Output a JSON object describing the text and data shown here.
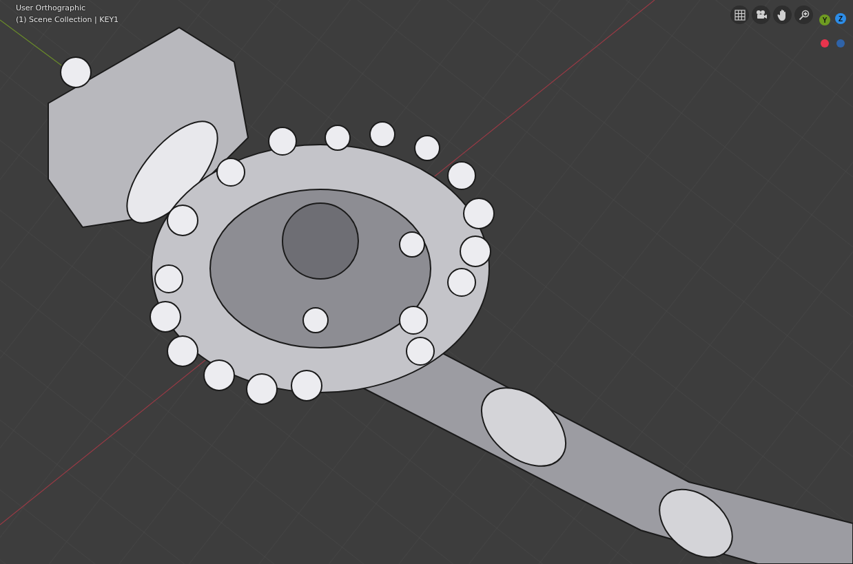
{
  "viewport": {
    "view_name": "User Orthographic",
    "collection_info": "(1) Scene Collection | KEY1"
  },
  "navigation_gizmo": {
    "axes": [
      {
        "label": "Y",
        "color": "#6e9b21"
      },
      {
        "label": "Z",
        "color": "#2c8de8"
      }
    ],
    "axis_dots": [
      {
        "color": "#e8344d"
      },
      {
        "color": "#2f63a8"
      }
    ]
  }
}
